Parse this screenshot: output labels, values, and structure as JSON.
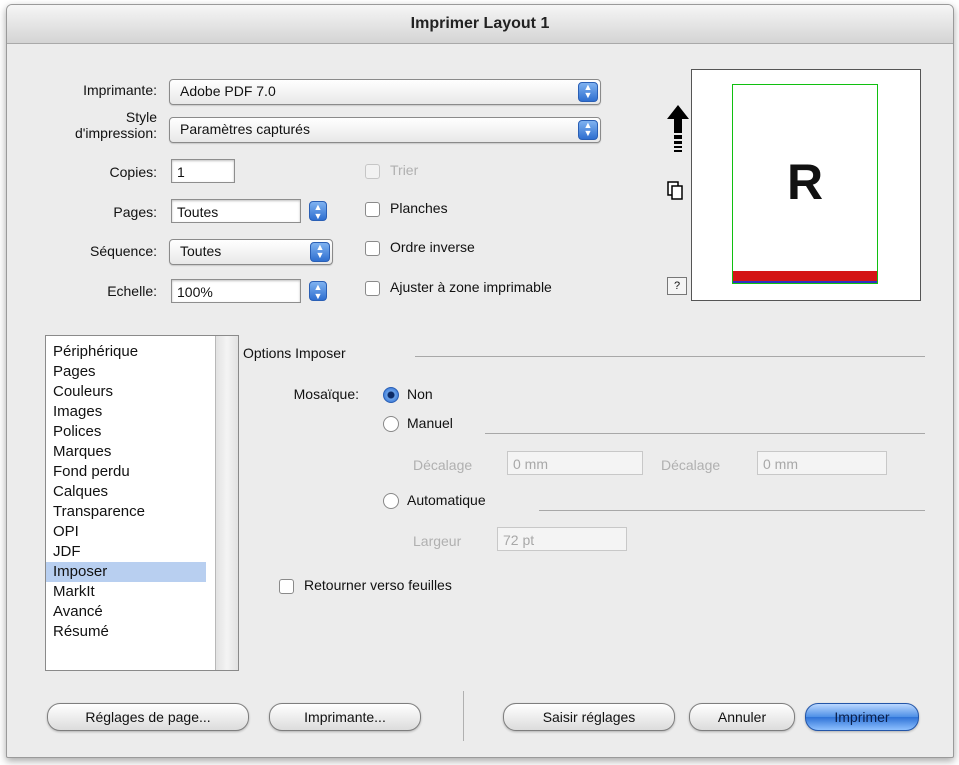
{
  "window": {
    "title": "Imprimer Layout 1"
  },
  "printer": {
    "label": "Imprimante:",
    "value": "Adobe PDF 7.0"
  },
  "style": {
    "label_line1": "Style",
    "label_line2": "d'impression:",
    "value": "Paramètres capturés"
  },
  "copies": {
    "label": "Copies:",
    "value": "1"
  },
  "pages": {
    "label": "Pages:",
    "value": "Toutes"
  },
  "sequence": {
    "label": "Séquence:",
    "value": "Toutes"
  },
  "scale": {
    "label": "Echelle:",
    "value": "100%"
  },
  "checkboxes": {
    "collate": "Trier",
    "spreads": "Planches",
    "reverse_order": "Ordre inverse",
    "fit": "Ajuster à zone imprimable"
  },
  "preview": {
    "letter": "R",
    "help": "?"
  },
  "sidebar": {
    "items": [
      "Périphérique",
      "Pages",
      "Couleurs",
      "Images",
      "Polices",
      "Marques",
      "Fond perdu",
      "Calques",
      "Transparence",
      "OPI",
      "JDF",
      "Imposer",
      "MarkIt",
      "Avancé",
      "Résumé"
    ],
    "selected_index": 11
  },
  "imposer": {
    "section_title": "Options Imposer",
    "mosaic_label": "Mosaïque:",
    "radio_non": "Non",
    "radio_manual": "Manuel",
    "offset_label_1": "Décalage",
    "offset_value_1": "0 mm",
    "offset_label_2": "Décalage",
    "offset_value_2": "0 mm",
    "radio_auto": "Automatique",
    "width_label": "Largeur",
    "width_value": "72 pt",
    "flip_label": "Retourner verso feuilles"
  },
  "buttons": {
    "page_setup": "Réglages de page...",
    "printer": "Imprimante...",
    "capture": "Saisir réglages",
    "cancel": "Annuler",
    "print": "Imprimer"
  },
  "colors": {
    "accent": "#2f73d7",
    "selection": "#b8cff0",
    "bleed": "#d41515",
    "margin_guide": "#10c010"
  }
}
